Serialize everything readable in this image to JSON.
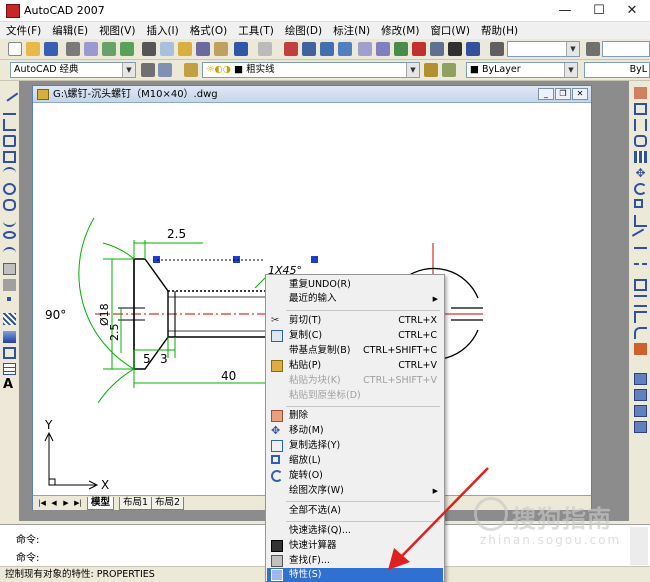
{
  "window": {
    "title": "AutoCAD 2007",
    "minimize": "—",
    "maximize": "☐",
    "close": "✕"
  },
  "menubar": [
    "文件(F)",
    "编辑(E)",
    "视图(V)",
    "插入(I)",
    "格式(O)",
    "工具(T)",
    "绘图(D)",
    "标注(N)",
    "修改(M)",
    "窗口(W)",
    "帮助(H)"
  ],
  "toolbar2": {
    "workspace": "AutoCAD 经典",
    "layer": "■ 粗实线",
    "color": "■ ByLayer",
    "linetype": "ByL"
  },
  "document": {
    "title": "G:\\螺钉-沉头螺钉（M10×40）.dwg"
  },
  "drawing": {
    "dim_top": "2.5",
    "dim_chamfer": "1X45°",
    "dim_angle": "90°",
    "dim_diameter": "Ø18",
    "dim_small": "2.5",
    "dim_5": "5",
    "dim_3": "3",
    "dim_length": "40",
    "axis_y": "Y",
    "axis_x": "X"
  },
  "tabs": {
    "model": "模型",
    "layout1": "布局1",
    "layout2": "布局2"
  },
  "command": {
    "line1": "命令:",
    "line2": "命令:"
  },
  "status": "控制现有对象的特性:  PROPERTIES",
  "context_menu": {
    "items": [
      {
        "label": "重复UNDO(R)",
        "shortcut": "",
        "sub": false,
        "disabled": false
      },
      {
        "label": "最近的输入",
        "shortcut": "",
        "sub": true,
        "disabled": false
      },
      {
        "label": "剪切(T)",
        "shortcut": "CTRL+X",
        "sub": false,
        "disabled": false
      },
      {
        "label": "复制(C)",
        "shortcut": "CTRL+C",
        "sub": false,
        "disabled": false
      },
      {
        "label": "带基点复制(B)",
        "shortcut": "CTRL+SHIFT+C",
        "sub": false,
        "disabled": false
      },
      {
        "label": "粘贴(P)",
        "shortcut": "CTRL+V",
        "sub": false,
        "disabled": false
      },
      {
        "label": "粘贴为块(K)",
        "shortcut": "CTRL+SHIFT+V",
        "sub": false,
        "disabled": true
      },
      {
        "label": "粘贴到原坐标(D)",
        "shortcut": "",
        "sub": false,
        "disabled": true
      },
      {
        "label": "删除",
        "shortcut": "",
        "sub": false,
        "disabled": false
      },
      {
        "label": "移动(M)",
        "shortcut": "",
        "sub": false,
        "disabled": false
      },
      {
        "label": "复制选择(Y)",
        "shortcut": "",
        "sub": false,
        "disabled": false
      },
      {
        "label": "缩放(L)",
        "shortcut": "",
        "sub": false,
        "disabled": false
      },
      {
        "label": "旋转(O)",
        "shortcut": "",
        "sub": false,
        "disabled": false
      },
      {
        "label": "绘图次序(W)",
        "shortcut": "",
        "sub": true,
        "disabled": false
      },
      {
        "label": "全部不选(A)",
        "shortcut": "",
        "sub": false,
        "disabled": false
      },
      {
        "label": "快速选择(Q)...",
        "shortcut": "",
        "sub": false,
        "disabled": false
      },
      {
        "label": "快速计算器",
        "shortcut": "",
        "sub": false,
        "disabled": false
      },
      {
        "label": "查找(F)...",
        "shortcut": "",
        "sub": false,
        "disabled": false
      },
      {
        "label": "特性(S)",
        "shortcut": "",
        "sub": false,
        "disabled": false
      }
    ]
  },
  "watermark": {
    "main": "搜狗指南",
    "sub": "zhinan.sogou.com"
  },
  "colors": {
    "highlight": "#3070d0",
    "dimension": "#00b000",
    "centerline": "#d00000",
    "grip": "#1a3fd0",
    "arrow": "#e02020"
  }
}
